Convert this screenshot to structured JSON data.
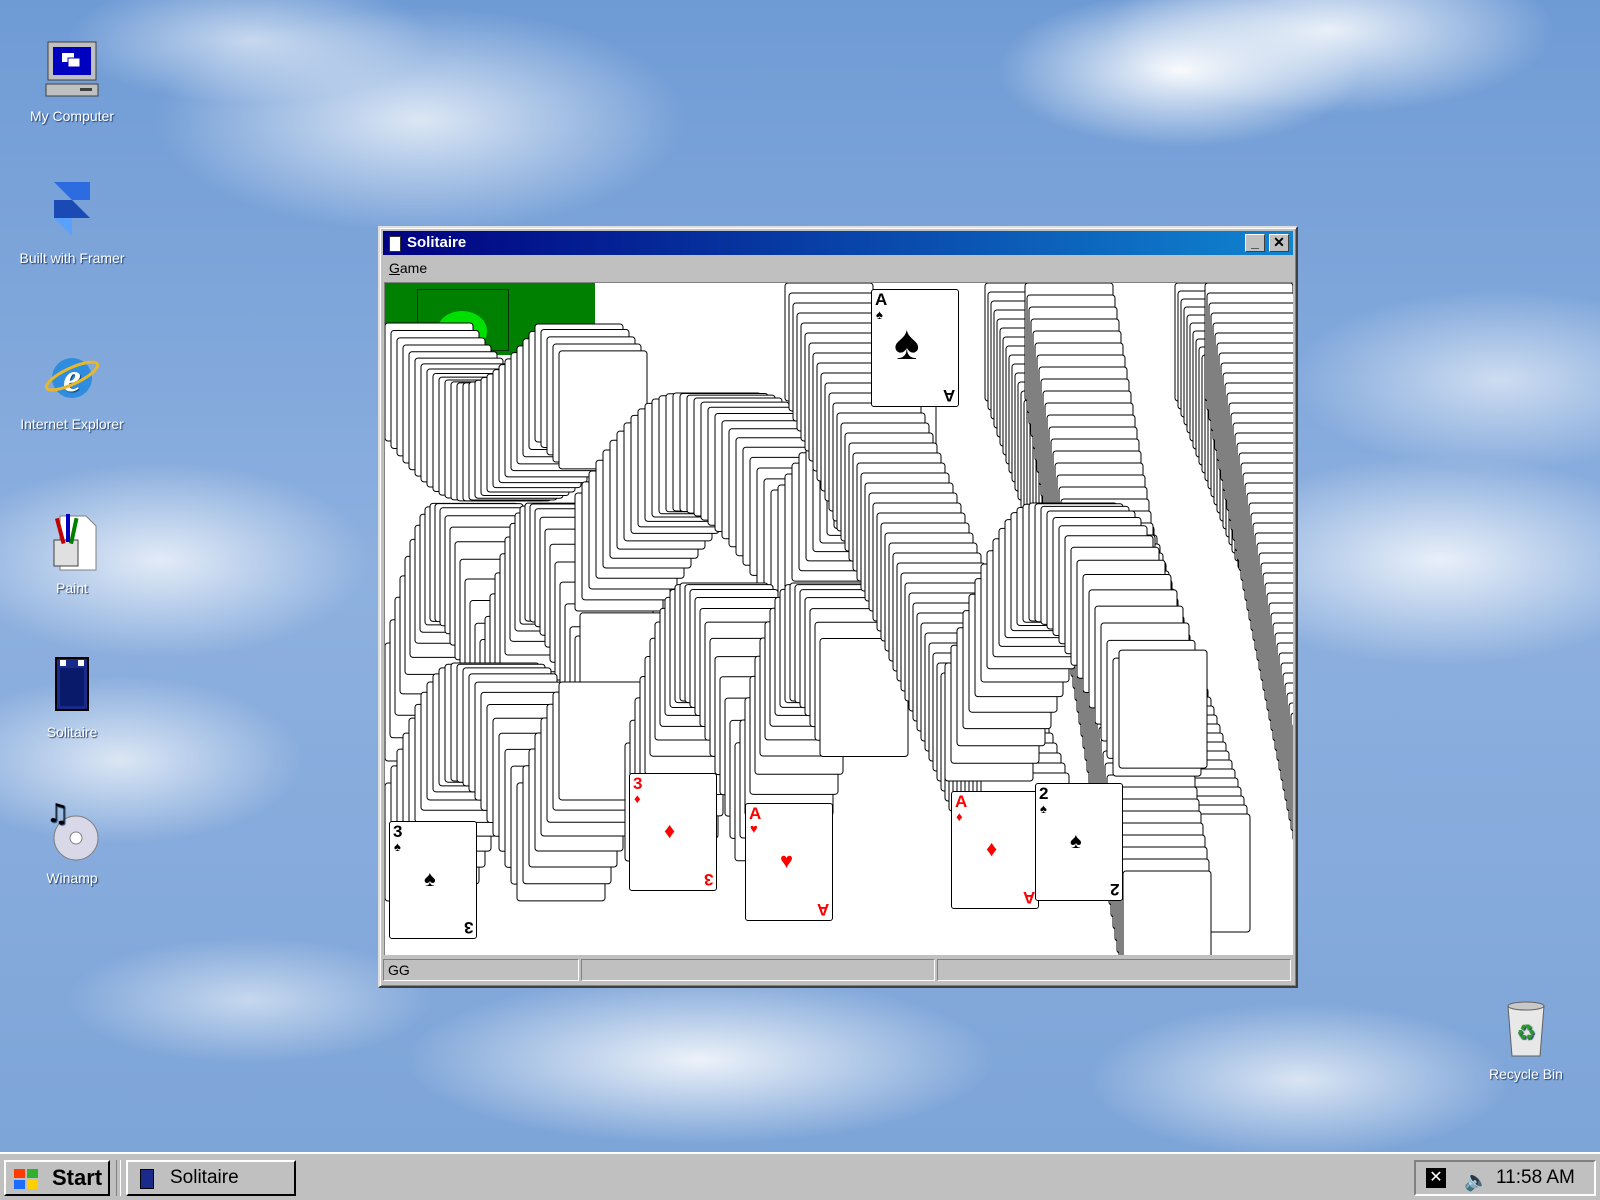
{
  "desktop": {
    "icons": [
      {
        "label": "My Computer"
      },
      {
        "label": "Built with Framer"
      },
      {
        "label": "Internet Explorer"
      },
      {
        "label": "Paint"
      },
      {
        "label": "Solitaire"
      },
      {
        "label": "Winamp"
      },
      {
        "label": "Recycle Bin"
      }
    ]
  },
  "window": {
    "title": "Solitaire",
    "menu": [
      {
        "label": "Game",
        "accel": "G",
        "rest": "ame"
      }
    ],
    "status": {
      "left": "GG",
      "middle": "",
      "right": ""
    }
  },
  "taskbar": {
    "start_label": "Start",
    "items": [
      {
        "label": "Solitaire"
      }
    ],
    "clock": "11:58 AM"
  },
  "colors": {
    "title_start": "#000080",
    "title_end": "#1084d0",
    "felt": "#008000",
    "card_red": "#ff0000"
  }
}
